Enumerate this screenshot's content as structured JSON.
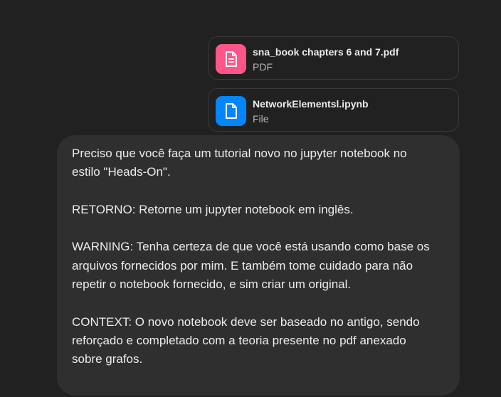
{
  "attachments": [
    {
      "name": "sna_book chapters 6 and 7.pdf",
      "type": "PDF",
      "icon": "document-text-icon",
      "color": "#ff5588"
    },
    {
      "name": "NetworkElementsl.ipynb",
      "type": "File",
      "icon": "document-icon",
      "color": "#0285ff"
    }
  ],
  "message": {
    "paragraphs": [
      "Preciso que você faça um tutorial novo no jupyter notebook no\nestilo \"Heads-On\".",
      "RETORNO: Retorne um jupyter notebook em inglês.",
      "WARNING: Tenha certeza de que você está usando como base os\narquivos fornecidos por mim. E também tome cuidado para não\nrepetir o notebook fornecido, e sim criar um original.",
      "CONTEXT: O novo notebook deve ser baseado no antigo, sendo\nreforçado e completado com a teoria presente no pdf anexado\nsobre grafos."
    ]
  },
  "colors": {
    "background": "#212121",
    "bubble": "#2f2f2f",
    "text": "#ececec",
    "muted": "#b4b4b4",
    "border": "#3a3a3a"
  }
}
